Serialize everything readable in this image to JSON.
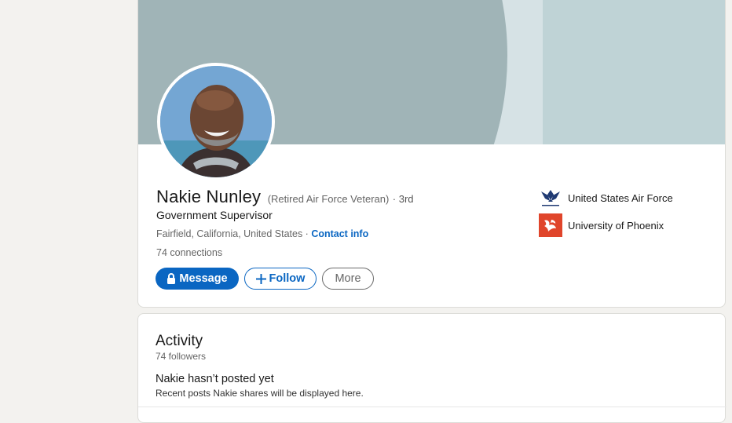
{
  "profile": {
    "name": "Nakie Nunley",
    "pronoun_note": "(Retired Air Force Veteran)",
    "degree": "· 3rd",
    "headline": "Government Supervisor",
    "location": "Fairfield, California, United States",
    "location_separator": " · ",
    "contact_info_label": "Contact info",
    "connections": "74 connections"
  },
  "actions": {
    "message_label": "Message",
    "follow_label": "Follow",
    "more_label": "More",
    "message_icon": "lock-icon",
    "follow_icon": "plus-icon"
  },
  "organizations": [
    {
      "label": "United States Air Force",
      "logo": "air-force-logo"
    },
    {
      "label": "University of Phoenix",
      "logo": "university-of-phoenix-logo"
    }
  ],
  "activity": {
    "title": "Activity",
    "followers": "74 followers",
    "empty_title": "Nakie hasn’t posted yet",
    "empty_description": "Recent posts Nakie shares will be displayed here."
  },
  "colors": {
    "page_background": "#f3f2ef",
    "accent": "#0a66c2",
    "banner_light": "#d6e2e5",
    "banner_arc": "#a0b4b7",
    "banner_panel": "#bfd3d6",
    "phoenix_red": "#e0452b",
    "air_force_navy": "#1f3a73"
  }
}
